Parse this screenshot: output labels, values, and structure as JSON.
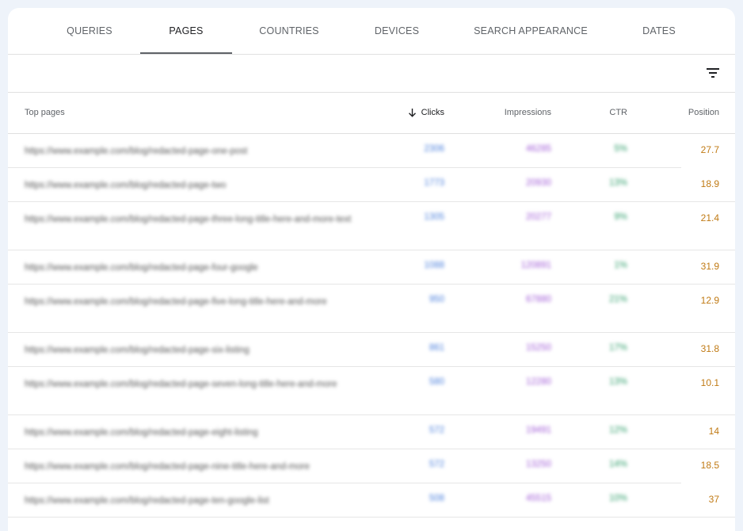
{
  "tabs": [
    {
      "label": "QUERIES"
    },
    {
      "label": "PAGES"
    },
    {
      "label": "COUNTRIES"
    },
    {
      "label": "DEVICES"
    },
    {
      "label": "SEARCH APPEARANCE"
    },
    {
      "label": "DATES"
    }
  ],
  "active_tab": "PAGES",
  "table": {
    "headers": {
      "pages": "Top pages",
      "clicks": "Clicks",
      "impressions": "Impressions",
      "ctr": "CTR",
      "position": "Position"
    },
    "sort_icon": "arrow-down-icon",
    "rows": [
      {
        "url": "https://www.example.com/blog/redacted-page-one-post",
        "clicks": "2306",
        "impressions": "46285",
        "ctr": "5%",
        "position": "27.7"
      },
      {
        "url": "https://www.example.com/blog/redacted-page-two",
        "clicks": "1773",
        "impressions": "20930",
        "ctr": "13%",
        "position": "18.9"
      },
      {
        "url": "https://www.example.com/blog/redacted-page-three-long-title-here-and-more-text",
        "clicks": "1305",
        "impressions": "20277",
        "ctr": "9%",
        "position": "21.4"
      },
      {
        "url": "https://www.example.com/blog/redacted-page-four-google",
        "clicks": "1088",
        "impressions": "120891",
        "ctr": "1%",
        "position": "31.9"
      },
      {
        "url": "https://www.example.com/blog/redacted-page-five-long-title-here-and-more",
        "clicks": "950",
        "impressions": "67880",
        "ctr": "21%",
        "position": "12.9"
      },
      {
        "url": "https://www.example.com/blog/redacted-page-six-listing",
        "clicks": "861",
        "impressions": "15250",
        "ctr": "17%",
        "position": "31.8"
      },
      {
        "url": "https://www.example.com/blog/redacted-page-seven-long-title-here-and-more",
        "clicks": "580",
        "impressions": "12280",
        "ctr": "13%",
        "position": "10.1"
      },
      {
        "url": "https://www.example.com/blog/redacted-page-eight-listing",
        "clicks": "572",
        "impressions": "19491",
        "ctr": "12%",
        "position": "14"
      },
      {
        "url": "https://www.example.com/blog/redacted-page-nine-title-here-and-more",
        "clicks": "572",
        "impressions": "13250",
        "ctr": "14%",
        "position": "18.5"
      },
      {
        "url": "https://www.example.com/blog/redacted-page-ten-google-list",
        "clicks": "508",
        "impressions": "45515",
        "ctr": "10%",
        "position": "37"
      }
    ]
  },
  "colors": {
    "clicks": "#4a7fdc",
    "impressions": "#a05bd6",
    "ctr": "#2f9d6a",
    "position": "#c07a14"
  },
  "icons": {
    "filter": "filter-icon"
  }
}
